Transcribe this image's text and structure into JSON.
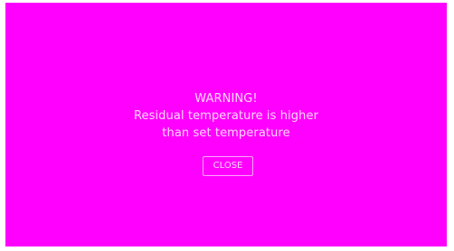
{
  "dialog": {
    "title": "WARNING!",
    "message_line1": "Residual temperature is higher",
    "message_line2": "than set temperature",
    "close_label": "CLOSE"
  },
  "colors": {
    "background": "#ff00ff",
    "text": "#ffd9ff",
    "button_border": "#ffa6ff"
  }
}
